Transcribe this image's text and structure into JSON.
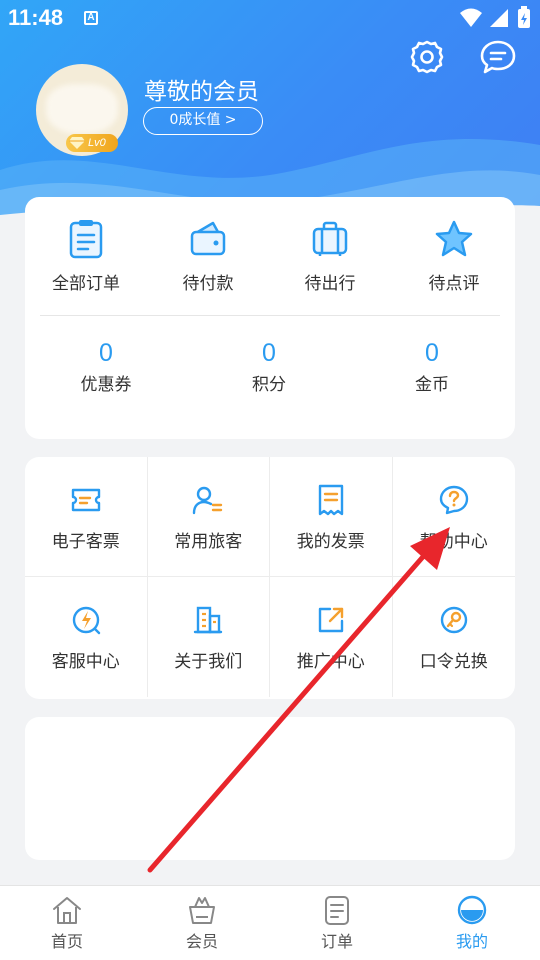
{
  "status_bar": {
    "time": "11:48",
    "notification_letter": "A"
  },
  "profile": {
    "title": "尊敬的会员",
    "growth_button": "0成长值 >",
    "level": "Lv0"
  },
  "orders": [
    {
      "label": "全部订单",
      "icon": "order-list-icon"
    },
    {
      "label": "待付款",
      "icon": "wallet-icon"
    },
    {
      "label": "待出行",
      "icon": "luggage-icon"
    },
    {
      "label": "待点评",
      "icon": "star-icon"
    }
  ],
  "stats": [
    {
      "value": "0",
      "label": "优惠券"
    },
    {
      "value": "0",
      "label": "积分"
    },
    {
      "value": "0",
      "label": "金币"
    }
  ],
  "services": [
    {
      "label": "电子客票",
      "icon": "ticket-icon"
    },
    {
      "label": "常用旅客",
      "icon": "traveler-icon"
    },
    {
      "label": "我的发票",
      "icon": "invoice-icon"
    },
    {
      "label": "帮助中心",
      "icon": "help-icon"
    },
    {
      "label": "客服中心",
      "icon": "customer-service-icon"
    },
    {
      "label": "关于我们",
      "icon": "building-icon"
    },
    {
      "label": "推广中心",
      "icon": "share-icon"
    },
    {
      "label": "口令兑换",
      "icon": "key-icon"
    }
  ],
  "tabs": [
    {
      "label": "首页",
      "icon": "home-icon"
    },
    {
      "label": "会员",
      "icon": "member-icon"
    },
    {
      "label": "订单",
      "icon": "order-icon"
    },
    {
      "label": "我的",
      "icon": "profile-icon",
      "active": true
    }
  ],
  "colors": {
    "primary": "#2a9bf0",
    "accent_orange": "#f5a02d",
    "header_blue": "#3a8cf6"
  }
}
